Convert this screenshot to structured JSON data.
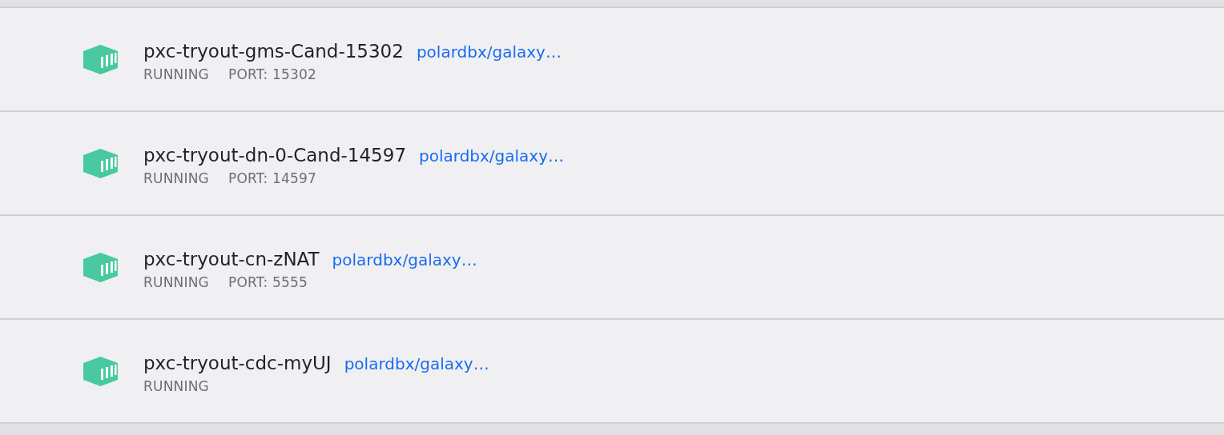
{
  "containers": [
    {
      "name": "pxc-tryout-gms-Cand-15302",
      "image": "polardbx/galaxy…",
      "status": "RUNNING",
      "port": "PORT: 15302"
    },
    {
      "name": "pxc-tryout-dn-0-Cand-14597",
      "image": "polardbx/galaxy…",
      "status": "RUNNING",
      "port": "PORT: 14597"
    },
    {
      "name": "pxc-tryout-cn-zNAT",
      "image": "polardbx/galaxy…",
      "status": "RUNNING",
      "port": "PORT: 5555"
    },
    {
      "name": "pxc-tryout-cdc-myUJ",
      "image": "polardbx/galaxy…",
      "status": "RUNNING"
    }
  ]
}
